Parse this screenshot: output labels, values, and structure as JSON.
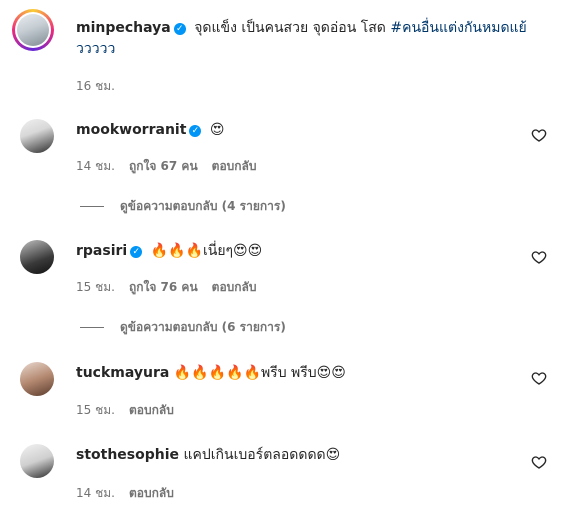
{
  "post": {
    "username": "minpechaya",
    "caption": "จุดแข็ง เป็นคนสวย จุดอ่อน โสด",
    "hashtag_part1": "#คนอื่นแต่งกันหมดแย้",
    "hashtag_part2": "ววววว",
    "time": "16 ชม."
  },
  "comments": [
    {
      "username": "mookworranit",
      "verified": true,
      "text": "😍",
      "time": "14 ชม.",
      "likes": "ถูกใจ 67 คน",
      "reply_label": "ตอบกลับ",
      "view_replies": "ดูข้อความตอบกลับ (4 รายการ)"
    },
    {
      "username": "rpasiri",
      "verified": true,
      "text": "🔥🔥🔥เนี่ยๆ😍😍",
      "time": "15 ชม.",
      "likes": "ถูกใจ 76 คน",
      "reply_label": "ตอบกลับ",
      "view_replies": "ดูข้อความตอบกลับ (6 รายการ)"
    },
    {
      "username": "tuckmayura",
      "verified": false,
      "text": "🔥🔥🔥🔥🔥พรีบ พรีบ😍😍",
      "time": "15 ชม.",
      "reply_label": "ตอบกลับ"
    },
    {
      "username": "stothesophie",
      "verified": false,
      "text": "แคปเกินเบอร์ตลอดดดด😍",
      "time": "14 ชม.",
      "reply_label": "ตอบกลับ"
    }
  ],
  "icons": {
    "verified": "verified-badge-icon",
    "like": "heart-outline-icon"
  },
  "colors": {
    "verified": "#0095f6",
    "hashtag": "#00376b",
    "secondary_text": "#737373"
  }
}
